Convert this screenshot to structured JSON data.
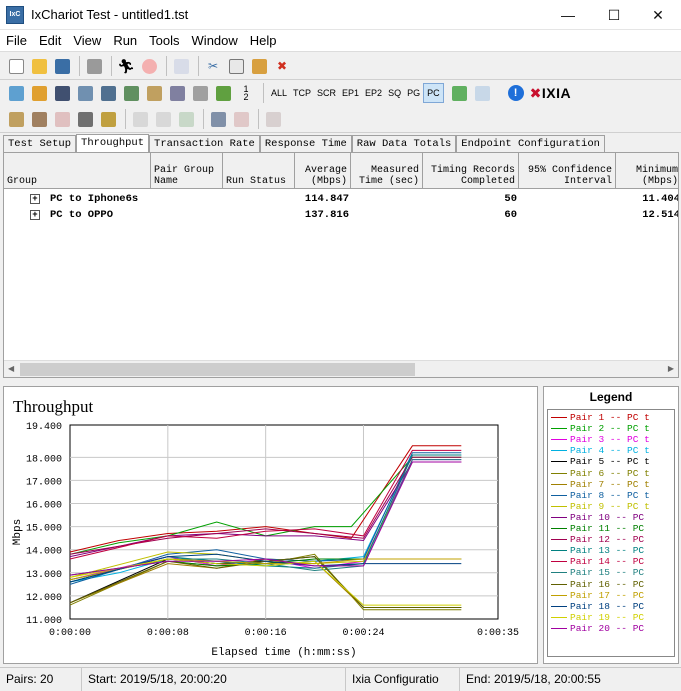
{
  "window": {
    "title": "IxChariot Test - untitled1.tst",
    "app_icon_text": "IxC"
  },
  "menu": [
    "File",
    "Edit",
    "View",
    "Run",
    "Tools",
    "Window",
    "Help"
  ],
  "toolbar2_text_buttons": [
    "ALL",
    "TCP",
    "SCR",
    "EP1",
    "EP2",
    "SQ",
    "PG",
    "PC"
  ],
  "toolbar2_active": "PC",
  "brand": {
    "logo_text": "IXIA",
    "logo_accent_color": "#c8102e"
  },
  "tabs": [
    "Test Setup",
    "Throughput",
    "Transaction Rate",
    "Response Time",
    "Raw Data Totals",
    "Endpoint Configuration"
  ],
  "active_tab": "Throughput",
  "table": {
    "headers": [
      [
        "",
        "Group"
      ],
      [
        "Pair Group",
        "Name"
      ],
      [
        "",
        "Run Status"
      ],
      [
        "Average",
        "(Mbps)"
      ],
      [
        "Measured",
        "Time (sec)"
      ],
      [
        "Timing Records",
        "Completed"
      ],
      [
        "95% Confidence",
        "Interval"
      ],
      [
        "Minimum",
        "(Mbps)"
      ]
    ],
    "rows": [
      {
        "group": "PC to Iphone6s",
        "average": "114.847",
        "records": "50",
        "minimum": "11.404"
      },
      {
        "group": "PC to OPPO",
        "average": "137.816",
        "records": "60",
        "minimum": "12.514"
      }
    ]
  },
  "chart_data": {
    "type": "line",
    "title": "Throughput",
    "xlabel": "Elapsed time (h:mm:ss)",
    "ylabel": "Mbps",
    "ylim": [
      11.0,
      19.4
    ],
    "yticks": [
      "19.400",
      "18.000",
      "17.000",
      "16.000",
      "15.000",
      "14.000",
      "13.000",
      "12.000",
      "11.000"
    ],
    "xticks": [
      "0:00:00",
      "0:00:08",
      "0:00:16",
      "0:00:24",
      "0:00:35"
    ],
    "xlim": [
      0,
      35
    ],
    "grid": true,
    "series": [
      {
        "name": "Pair 1 -- PC t",
        "color": "#c00000",
        "x": [
          0,
          4,
          8,
          12,
          16,
          20,
          23,
          28,
          32
        ],
        "y": [
          13.9,
          14.4,
          14.7,
          14.8,
          15.0,
          14.7,
          14.5,
          18.5,
          18.5
        ]
      },
      {
        "name": "Pair 2 -- PC t",
        "color": "#00a000",
        "x": [
          0,
          4,
          8,
          12,
          16,
          20,
          23,
          28,
          32
        ],
        "y": [
          13.8,
          14.3,
          14.6,
          15.2,
          14.6,
          15.0,
          15.0,
          18.0,
          18.0
        ]
      },
      {
        "name": "Pair 3 -- PC t",
        "color": "#e000e0",
        "x": [
          0,
          4,
          8,
          12,
          16,
          20,
          24,
          28,
          32
        ],
        "y": [
          12.7,
          13.2,
          13.7,
          13.3,
          13.6,
          13.2,
          13.5,
          17.9,
          17.9
        ]
      },
      {
        "name": "Pair 4 -- PC t",
        "color": "#00b0e0",
        "x": [
          0,
          4,
          8,
          12,
          16,
          20,
          24,
          28,
          32
        ],
        "y": [
          12.6,
          13.0,
          13.6,
          13.4,
          13.3,
          13.5,
          13.7,
          18.1,
          18.1
        ]
      },
      {
        "name": "Pair 5 -- PC t",
        "color": "#000000",
        "x": [
          0,
          8,
          12,
          16,
          20,
          24,
          28,
          32
        ],
        "y": [
          11.7,
          13.6,
          13.4,
          13.5,
          13.7,
          11.5,
          11.5,
          11.5
        ]
      },
      {
        "name": "Pair 6 -- PC t",
        "color": "#808000",
        "x": [
          0,
          8,
          12,
          16,
          20,
          24,
          28,
          32
        ],
        "y": [
          11.6,
          13.5,
          13.3,
          13.4,
          13.8,
          11.4,
          11.4,
          11.4
        ]
      },
      {
        "name": "Pair 7 -- PC t",
        "color": "#a08000",
        "x": [
          0,
          8,
          12,
          16,
          20,
          24,
          28,
          32
        ],
        "y": [
          11.7,
          13.4,
          13.2,
          13.6,
          13.5,
          11.5,
          11.5,
          11.5
        ]
      },
      {
        "name": "Pair 8 -- PC t",
        "color": "#1060a0",
        "x": [
          0,
          8,
          12,
          16,
          20,
          24,
          28,
          32
        ],
        "y": [
          12.5,
          13.8,
          14.0,
          13.6,
          13.5,
          13.6,
          18.2,
          18.2
        ]
      },
      {
        "name": "Pair 9 -- PC t",
        "color": "#c0c000",
        "x": [
          0,
          8,
          12,
          16,
          20,
          24,
          28,
          32
        ],
        "y": [
          12.8,
          13.9,
          13.8,
          13.5,
          13.4,
          13.5,
          17.8,
          17.8
        ]
      },
      {
        "name": "Pair 10 -- PC",
        "color": "#800080",
        "x": [
          0,
          8,
          12,
          16,
          20,
          24,
          28,
          32
        ],
        "y": [
          13.7,
          14.6,
          14.7,
          14.6,
          14.6,
          14.4,
          17.8,
          17.8
        ]
      },
      {
        "name": "Pair 11 -- PC",
        "color": "#008000",
        "x": [
          0,
          8,
          12,
          16,
          20,
          24,
          28,
          32
        ],
        "y": [
          12.9,
          13.5,
          13.3,
          13.4,
          13.6,
          13.6,
          13.6,
          13.6
        ]
      },
      {
        "name": "Pair 12 -- PC",
        "color": "#a00050",
        "x": [
          0,
          8,
          12,
          16,
          20,
          24,
          28,
          32
        ],
        "y": [
          13.8,
          14.5,
          14.7,
          14.9,
          14.7,
          14.5,
          18.0,
          18.0
        ]
      },
      {
        "name": "Pair 13 -- PC",
        "color": "#008080",
        "x": [
          0,
          8,
          12,
          16,
          20,
          24,
          28,
          32
        ],
        "y": [
          12.6,
          13.7,
          13.5,
          13.3,
          13.2,
          13.4,
          18.1,
          18.1
        ]
      },
      {
        "name": "Pair 14 -- PC",
        "color": "#c00040",
        "x": [
          0,
          8,
          12,
          16,
          20,
          24,
          28,
          32
        ],
        "y": [
          13.6,
          14.6,
          14.5,
          14.8,
          14.9,
          14.6,
          18.3,
          18.3
        ]
      },
      {
        "name": "Pair 15 -- PC",
        "color": "#208080",
        "x": [
          0,
          8,
          12,
          16,
          20,
          24,
          28,
          32
        ],
        "y": [
          12.7,
          13.6,
          13.6,
          13.4,
          13.1,
          13.3,
          17.9,
          17.9
        ]
      },
      {
        "name": "Pair 16 -- PC",
        "color": "#606000",
        "x": [
          0,
          8,
          12,
          16,
          20,
          24,
          28,
          32
        ],
        "y": [
          11.7,
          13.5,
          13.2,
          13.5,
          13.7,
          11.5,
          11.5,
          11.5
        ]
      },
      {
        "name": "Pair 17 -- PC",
        "color": "#c0a000",
        "x": [
          0,
          8,
          12,
          16,
          20,
          24,
          28,
          32
        ],
        "y": [
          12.7,
          13.6,
          13.5,
          13.4,
          13.4,
          13.6,
          13.6,
          13.6
        ]
      },
      {
        "name": "Pair 18 -- PC",
        "color": "#004080",
        "x": [
          0,
          8,
          12,
          16,
          20,
          24,
          28,
          32
        ],
        "y": [
          12.6,
          13.7,
          13.8,
          13.5,
          13.3,
          13.4,
          13.4,
          13.4
        ]
      },
      {
        "name": "Pair 19 -- PC",
        "color": "#d0d000",
        "x": [
          0,
          8,
          12,
          16,
          20,
          24,
          28,
          32
        ],
        "y": [
          12.8,
          13.6,
          13.4,
          13.3,
          13.5,
          11.6,
          11.6,
          11.6
        ]
      },
      {
        "name": "Pair 20 -- PC",
        "color": "#a000a0",
        "x": [
          0,
          8,
          12,
          16,
          20,
          24,
          28,
          32
        ],
        "y": [
          12.9,
          13.5,
          13.5,
          13.6,
          13.3,
          13.3,
          17.8,
          17.8
        ]
      }
    ]
  },
  "legend": {
    "title": "Legend"
  },
  "status": {
    "pairs": "Pairs: 20",
    "start": "Start: 2019/5/18, 20:00:20",
    "config": "Ixia Configuratio",
    "end": "End: 2019/5/18, 20:00:55"
  }
}
